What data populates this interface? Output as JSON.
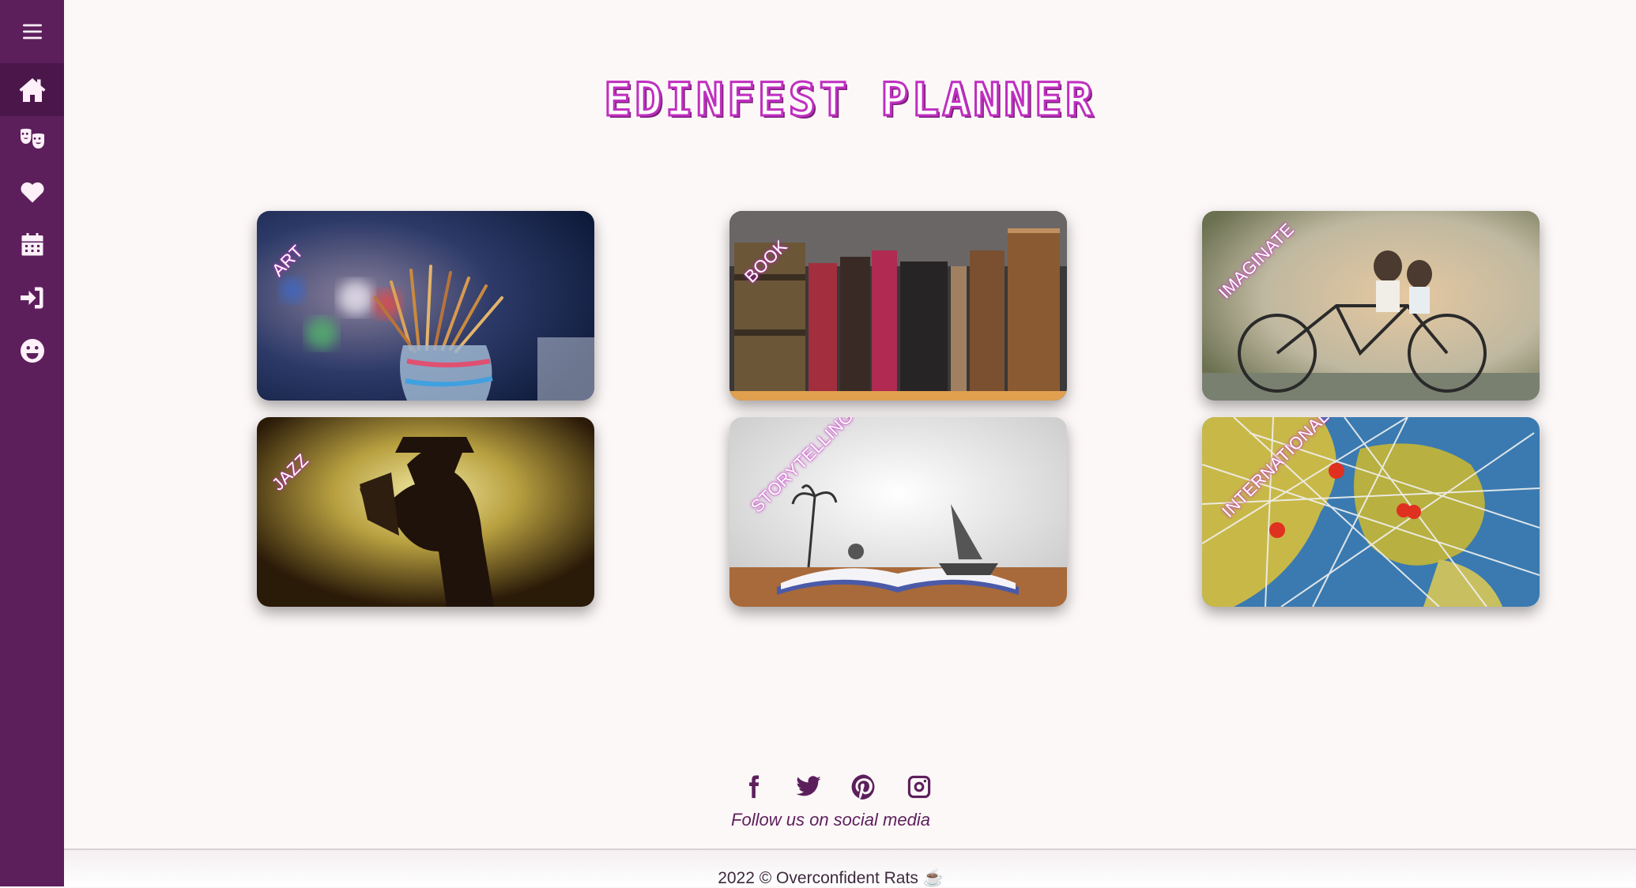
{
  "nav": {
    "items": [
      {
        "icon": "menu-icon"
      },
      {
        "icon": "home-icon",
        "active": true
      },
      {
        "icon": "theater-masks-icon"
      },
      {
        "icon": "heart-icon"
      },
      {
        "icon": "calendar-icon"
      },
      {
        "icon": "sign-in-icon"
      },
      {
        "icon": "smile-icon"
      }
    ]
  },
  "page": {
    "title": "EDINFEST PLANNER"
  },
  "cards": [
    {
      "label": "ART"
    },
    {
      "label": "BOOK"
    },
    {
      "label": "IMAGINATE"
    },
    {
      "label": "JAZZ"
    },
    {
      "label": "STORYTELLING"
    },
    {
      "label": "INTERNATIONAL"
    }
  ],
  "footer": {
    "social": [
      "facebook-icon",
      "twitter-icon",
      "pinterest-icon",
      "instagram-icon"
    ],
    "follow_text": "Follow us on social media",
    "copyright": "2022 © Overconfident Rats ☕"
  },
  "colors": {
    "sidebar": "#5c1f5c",
    "accent": "#c02fc0",
    "background": "#fdf8f8"
  }
}
